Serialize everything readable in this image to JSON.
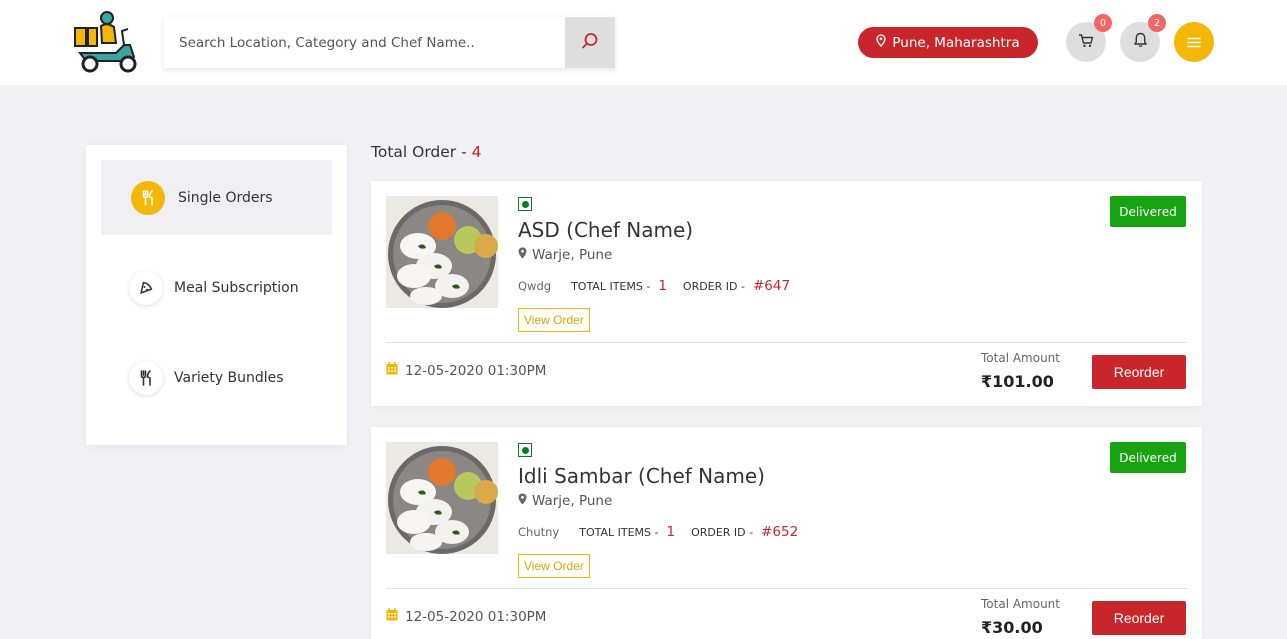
{
  "header": {
    "search_placeholder": "Search Location, Category and Chef Name..",
    "location": "Pune, Maharashtra",
    "cart_count": "0",
    "notification_count": "2"
  },
  "sidebar": {
    "items": [
      {
        "label": "Single Orders",
        "icon": "fork-knife-icon",
        "active": true
      },
      {
        "label": "Meal Subscription",
        "icon": "pizza-icon",
        "active": false
      },
      {
        "label": "Variety Bundles",
        "icon": "utensils-icon",
        "active": false
      }
    ]
  },
  "orders_summary": {
    "label": "Total Order -",
    "count": "4"
  },
  "orders": [
    {
      "chef": "ASD (Chef Name)",
      "location": "Warje, Pune",
      "dish": "Qwdg",
      "total_items_label": "TOTAL ITEMS -",
      "total_items": "1",
      "order_id_label": "ORDER ID -",
      "order_id": "#647",
      "view_label": "View Order",
      "status": "Delivered",
      "date": "12-05-2020 01:30PM",
      "amount_label": "Total Amount",
      "amount": "₹101.00",
      "reorder_label": "Reorder"
    },
    {
      "chef": "Idli Sambar (Chef Name)",
      "location": "Warje, Pune",
      "dish": "Chutny",
      "total_items_label": "TOTAL ITEMS -",
      "total_items": "1",
      "order_id_label": "ORDER ID -",
      "order_id": "#652",
      "view_label": "View Order",
      "status": "Delivered",
      "date": "12-05-2020 01:30PM",
      "amount_label": "Total Amount",
      "amount": "₹30.00",
      "reorder_label": "Reorder"
    }
  ],
  "colors": {
    "brand_red": "#c9262c",
    "brand_yellow": "#f2b707",
    "delivered_green": "#18a313",
    "veg_green": "#0d7a1f"
  }
}
